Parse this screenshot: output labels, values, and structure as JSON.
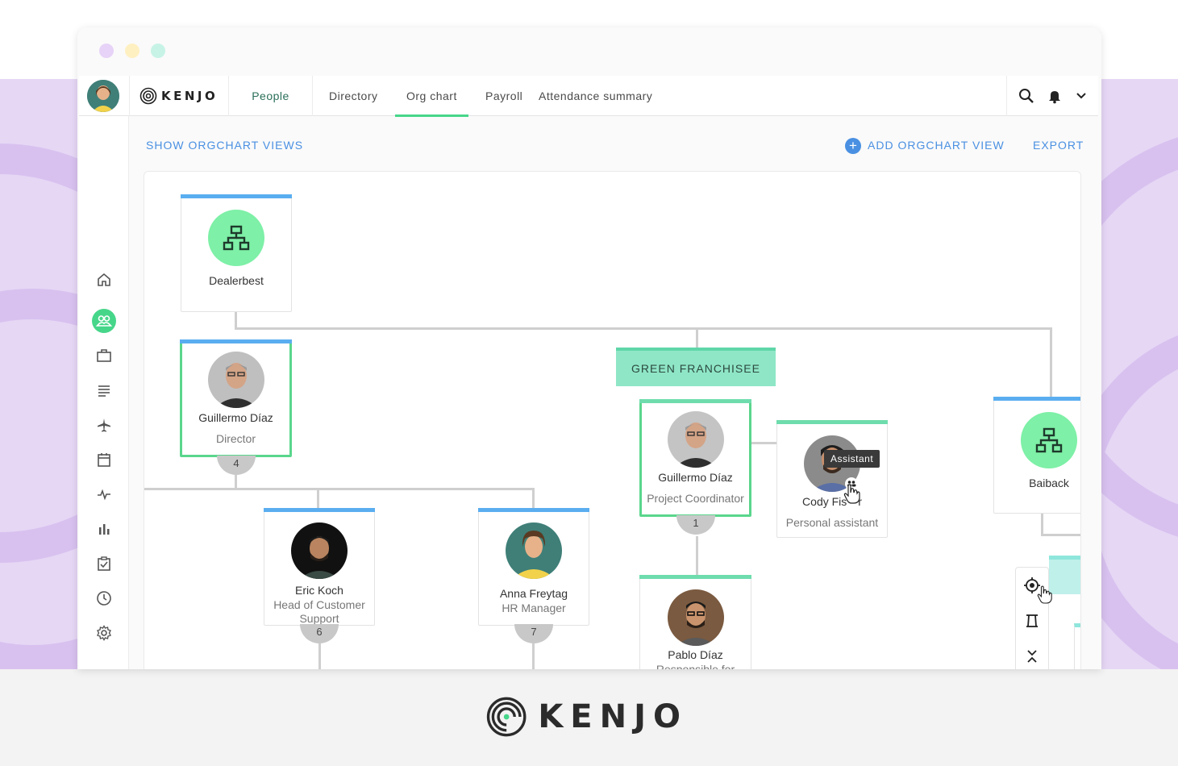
{
  "window": {
    "traffic_colors": [
      "#e7d3f7",
      "#fff0c2",
      "#c7f3e6"
    ]
  },
  "brand": {
    "name": "KENJO"
  },
  "nav": {
    "people": "People",
    "tabs": [
      {
        "label": "Directory"
      },
      {
        "label": "Org chart",
        "active": true
      },
      {
        "label": "Payroll"
      },
      {
        "label": "Attendance summary"
      }
    ],
    "right_icons": [
      "search-icon",
      "bell-icon",
      "chevron-down-icon"
    ]
  },
  "sidebar": {
    "items": [
      {
        "icon": "home-icon"
      },
      {
        "icon": "people-icon",
        "active": true
      },
      {
        "icon": "briefcase-icon"
      },
      {
        "icon": "list-icon"
      },
      {
        "icon": "airplane-icon"
      },
      {
        "icon": "calendar-icon"
      },
      {
        "icon": "pulse-icon"
      },
      {
        "icon": "bar-chart-icon"
      },
      {
        "icon": "clipboard-check-icon"
      },
      {
        "icon": "clock-icon"
      },
      {
        "icon": "gear-icon"
      }
    ]
  },
  "toolbar": {
    "show_views": "SHOW ORGCHART VIEWS",
    "add_view": "ADD ORGCHART VIEW",
    "export": "EXPORT"
  },
  "org": {
    "root": {
      "name": "Dealerbest"
    },
    "director": {
      "name": "Guillermo Díaz",
      "role": "Director",
      "count": "4"
    },
    "franchisee_label": "GREEN FRANCHISEE",
    "coordinator": {
      "name": "Guillermo Díaz",
      "role": "Project Coordinator",
      "count": "1"
    },
    "assistant": {
      "name": "Cody Fisher",
      "name_visible": "Cody Fis",
      "name_tail": "r",
      "role": "Personal assistant",
      "tooltip": "Assistant"
    },
    "baiback": {
      "name": "Baiback"
    },
    "eric": {
      "name": "Eric Koch",
      "role": "Head of Customer Support",
      "count": "6"
    },
    "anna": {
      "name": "Anna Freytag",
      "role": "HR Manager",
      "count": "7"
    },
    "pablo": {
      "name": "Pablo Díaz",
      "role": "Responsible for"
    }
  },
  "zoom": {
    "icons": [
      "locate-icon",
      "fit-icon",
      "collapse-icon"
    ]
  },
  "colors": {
    "accent_green": "#46d68a",
    "link_blue": "#4a90e2",
    "dept_blue": "#5aaef0",
    "team_green": "#6fdcad"
  },
  "footer": {
    "brand": "KENJO"
  }
}
